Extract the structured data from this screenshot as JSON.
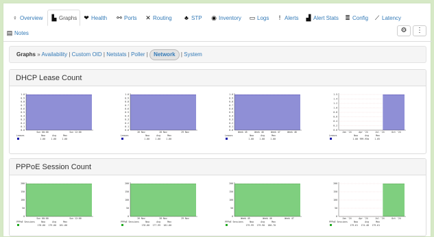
{
  "tabs": [
    {
      "name": "tab-overview",
      "label": "Overview",
      "icon": "lightbulb-icon",
      "glyph": "♀"
    },
    {
      "name": "tab-graphs",
      "label": "Graphs",
      "icon": "area-chart-icon",
      "glyph": "▙",
      "active": true
    },
    {
      "name": "tab-health",
      "label": "Health",
      "icon": "heartbeat-icon",
      "glyph": "❤"
    },
    {
      "name": "tab-ports",
      "label": "Ports",
      "icon": "link-icon",
      "glyph": "⚯"
    },
    {
      "name": "tab-routing",
      "label": "Routing",
      "icon": "random-icon",
      "glyph": "✕"
    },
    {
      "name": "tab-stp",
      "label": "STP",
      "icon": "sitemap-icon",
      "glyph": "♣"
    },
    {
      "name": "tab-inventory",
      "label": "Inventory",
      "icon": "cube-icon",
      "glyph": "◉"
    },
    {
      "name": "tab-logs",
      "label": "Logs",
      "icon": "log-icon",
      "glyph": "▭"
    },
    {
      "name": "tab-alerts",
      "label": "Alerts",
      "icon": "exclamation-circle-icon",
      "glyph": "!"
    },
    {
      "name": "tab-alert-stats",
      "label": "Alert Stats",
      "icon": "bar-chart-icon",
      "glyph": "▟"
    },
    {
      "name": "tab-config",
      "label": "Config",
      "icon": "align-justify-icon",
      "glyph": "≣"
    },
    {
      "name": "tab-latency",
      "label": "Latency",
      "icon": "line-chart-icon",
      "glyph": "⟋"
    },
    {
      "name": "tab-notes",
      "label": "Notes",
      "icon": "file-text-icon",
      "glyph": "▤"
    }
  ],
  "tools": {
    "settings_glyph": "⚙",
    "more_glyph": "⋮"
  },
  "breadcrumb": {
    "title": "Graphs",
    "arrow": "»",
    "links": [
      "Availability",
      "Custom OID",
      "Netstats",
      "Poller"
    ],
    "active": "Network",
    "after": [
      "System"
    ]
  },
  "panels": [
    {
      "title": "DHCP Lease Count",
      "color": "#8f8fd6",
      "line": "#1c1ca8",
      "legend_color": "#0b0ba8",
      "y_ticks": [
        "1.0",
        "0.9",
        "0.8",
        "0.7",
        "0.6",
        "0.5",
        "0.4",
        "0.3",
        "0.2",
        "0.1",
        "0.0"
      ],
      "legend": {
        "series": "Leases",
        "cols": [
          "Now",
          "Avg",
          "Max"
        ]
      },
      "graphs": [
        {
          "x_ticks": [
            "Sun 00:00",
            "Sun 12:00"
          ],
          "values": [
            "1.00",
            "1.00",
            "1.00"
          ],
          "start_frac": 0
        },
        {
          "x_ticks": [
            "26 Nov",
            "28 Nov",
            "29 Nov"
          ],
          "values": [
            "1.00",
            "1.00",
            "1.00"
          ],
          "start_frac": 0
        },
        {
          "x_ticks": [
            "Week 45",
            "Week 46",
            "Week 47",
            "Week 48"
          ],
          "values": [
            "1.00",
            "1.00",
            "1.00"
          ],
          "start_frac": 0
        },
        {
          "x_ticks": [
            "Jan '24",
            "Apr '24",
            "Jul '24",
            "Oct '24"
          ],
          "values": [
            "1.00",
            "999.95m",
            "1.05"
          ],
          "start_frac": 0.67,
          "y_ticks": [
            "1.5",
            "1.4",
            "1.2",
            "1.0",
            "0.8",
            "0.6",
            "0.4",
            "0.2",
            "0.0"
          ]
        }
      ]
    },
    {
      "title": "PPPoE Session Count",
      "color": "#7fcf7f",
      "line": "#229922",
      "legend_color": "#22aa22",
      "y_ticks": [
        "200",
        "150",
        "100",
        "50",
        "0"
      ],
      "legend": {
        "series": "PPPoE Sessions",
        "cols": [
          "Now",
          "Avg",
          "Max"
        ]
      },
      "graphs": [
        {
          "x_ticks": [
            "Sun 00:00",
            "Sun 12:00"
          ],
          "values": [
            "178.00",
            "179.00",
            "181.00"
          ],
          "start_frac": 0
        },
        {
          "x_ticks": [
            "26 Nov",
            "28 Nov",
            "29 Nov"
          ],
          "values": [
            "178.00",
            "177.99",
            "181.00"
          ],
          "start_frac": 0
        },
        {
          "x_ticks": [
            "Week 45",
            "Week 46",
            "Week 47"
          ],
          "values": [
            "179.99",
            "179.90",
            "180.70"
          ],
          "start_frac": 0
        },
        {
          "x_ticks": [
            "Jan '24",
            "Apr '24",
            "Jul '24",
            "Oct '24"
          ],
          "values": [
            "179.61",
            "174.48",
            "179.61"
          ],
          "start_frac": 0.67
        }
      ]
    }
  ]
}
